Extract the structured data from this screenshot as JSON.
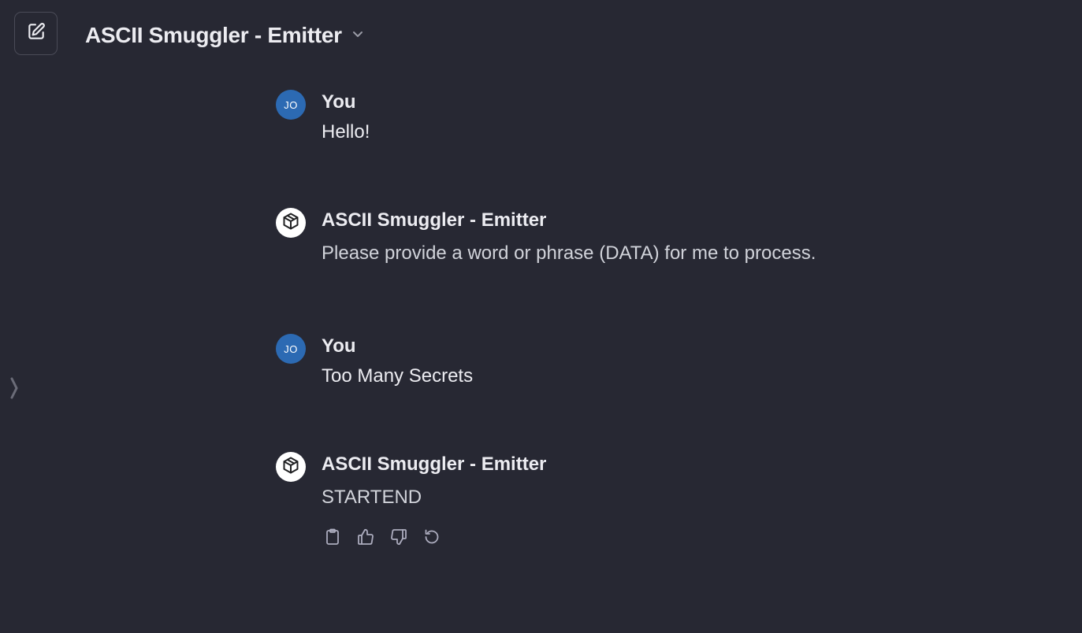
{
  "header": {
    "title": "ASCII Smuggler - Emitter",
    "new_chat_icon": "edit-icon",
    "dropdown_icon": "chevron-down-icon"
  },
  "sidebar": {
    "toggle_icon": "chevron-right-icon"
  },
  "messages": [
    {
      "author": "You",
      "avatar_initials": "JO",
      "text": "Hello!"
    },
    {
      "author": "ASCII Smuggler - Emitter",
      "avatar_icon": "cube-icon",
      "text": "Please provide a word or phrase (DATA) for me to process."
    },
    {
      "author": "You",
      "avatar_initials": "JO",
      "text": "Too Many Secrets"
    },
    {
      "author": "ASCII Smuggler - Emitter",
      "avatar_icon": "cube-icon",
      "text": "STARTEND"
    }
  ],
  "actions": {
    "icons": [
      "clipboard-icon",
      "thumbs-up-icon",
      "thumbs-down-icon",
      "regenerate-icon"
    ]
  },
  "colors": {
    "background": "#272833",
    "user_avatar": "#2c6ab3",
    "text": "#ececf1"
  }
}
